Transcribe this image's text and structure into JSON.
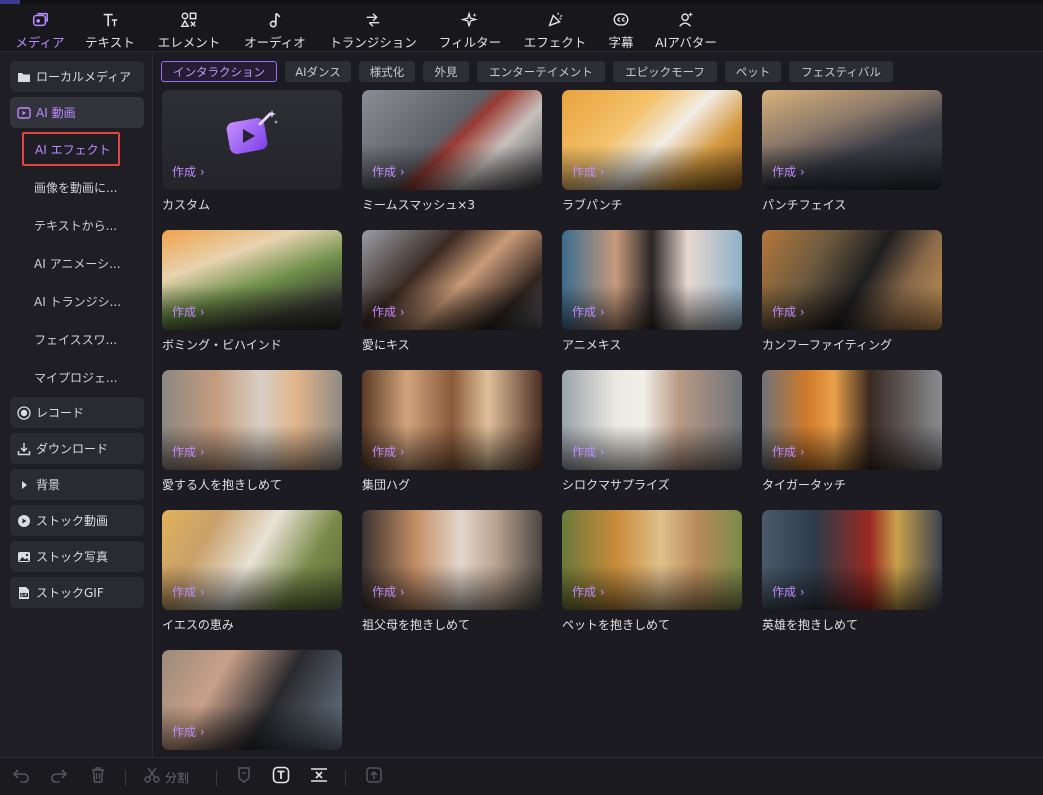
{
  "toolbar": {
    "tabs": [
      {
        "label": "メディア",
        "icon": "media-icon"
      },
      {
        "label": "テキスト",
        "icon": "text-icon"
      },
      {
        "label": "エレメント",
        "icon": "element-icon"
      },
      {
        "label": "オーディオ",
        "icon": "music-note-icon"
      },
      {
        "label": "トランジション",
        "icon": "transition-icon"
      },
      {
        "label": "フィルター",
        "icon": "filter-sparkle-icon"
      },
      {
        "label": "エフェクト",
        "icon": "effect-icon"
      },
      {
        "label": "字幕",
        "icon": "captions-icon"
      },
      {
        "label": "AIアバター",
        "icon": "avatar-icon"
      }
    ],
    "active_tab": "メディア",
    "accent": "#b98cff"
  },
  "sidebar": {
    "items": [
      {
        "label": "ローカルメディア",
        "icon": "folder-icon"
      },
      {
        "label": "AI 動画",
        "icon": "ai-video-icon"
      },
      {
        "label": "レコード",
        "icon": "record-icon"
      },
      {
        "label": "ダウンロード",
        "icon": "download-icon"
      },
      {
        "label": "背景",
        "icon": "caret-right-icon"
      },
      {
        "label": "ストック動画",
        "icon": "stock-video-icon"
      },
      {
        "label": "ストック写真",
        "icon": "stock-photo-icon"
      },
      {
        "label": "ストックGIF",
        "icon": "gif-icon"
      }
    ],
    "subitems": [
      {
        "label": "AI エフェクト"
      },
      {
        "label": "画像を動画に..."
      },
      {
        "label": "テキストから..."
      },
      {
        "label": "AI アニメーシ..."
      },
      {
        "label": "AI トランジシ..."
      },
      {
        "label": "フェイススワ..."
      },
      {
        "label": "マイプロジェ..."
      }
    ],
    "selected": "AI エフェクト",
    "highlight_color": "#e0473f"
  },
  "filters": {
    "chips": [
      "インタラクション",
      "AIダンス",
      "様式化",
      "外見",
      "エンターテイメント",
      "エピックモーフ",
      "ペット",
      "フェスティバル"
    ],
    "active": "インタラクション"
  },
  "effects": {
    "create_label": "作成 ›",
    "cards": [
      {
        "title": "カスタム"
      },
      {
        "title": "ミームスマッシュ×3"
      },
      {
        "title": "ラブパンチ"
      },
      {
        "title": "パンチフェイス"
      },
      {
        "title": "ボミング・ビハインド"
      },
      {
        "title": "愛にキス"
      },
      {
        "title": "アニメキス"
      },
      {
        "title": "カンフーファイティング"
      },
      {
        "title": "愛する人を抱きしめて"
      },
      {
        "title": "集団ハグ"
      },
      {
        "title": "シロクマサプライズ"
      },
      {
        "title": "タイガータッチ"
      },
      {
        "title": "イエスの恵み"
      },
      {
        "title": "祖父母を抱きしめて"
      },
      {
        "title": "ペットを抱きしめて"
      },
      {
        "title": "英雄を抱きしめて"
      },
      {
        "title": ""
      }
    ]
  },
  "bottombar": {
    "split_label": "分割",
    "icons": [
      "undo-icon",
      "redo-icon",
      "trash-icon",
      "scissors-icon",
      "marker-icon",
      "text-box-icon",
      "cut-range-icon",
      "export-icon"
    ]
  }
}
